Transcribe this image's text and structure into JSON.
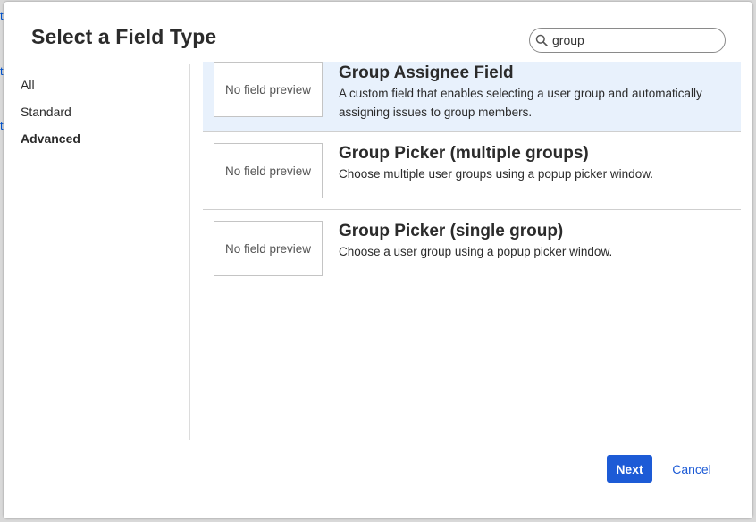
{
  "background": {
    "link_fragments": [
      "t",
      "t"
    ]
  },
  "dialog": {
    "title": "Select a Field Type",
    "search": {
      "value": "group",
      "placeholder": "",
      "icon": "search-icon"
    },
    "nav": {
      "items": [
        {
          "label": "All",
          "active": false
        },
        {
          "label": "Standard",
          "active": false
        },
        {
          "label": "Advanced",
          "active": true
        }
      ]
    },
    "results": [
      {
        "preview": "No field preview",
        "title": "Group Assignee Field",
        "description": "A custom field that enables selecting a user group and automatically assigning issues to group members.",
        "selected": true
      },
      {
        "preview": "No field preview",
        "title": "Group Picker (multiple groups)",
        "description": "Choose multiple user groups using a popup picker window.",
        "selected": false
      },
      {
        "preview": "No field preview",
        "title": "Group Picker (single group)",
        "description": "Choose a user group using a popup picker window.",
        "selected": false
      }
    ],
    "buttons": {
      "next": "Next",
      "cancel": "Cancel"
    },
    "colors": {
      "primary": "#1d5bd6",
      "selected_row": "#e8f1fc"
    }
  }
}
